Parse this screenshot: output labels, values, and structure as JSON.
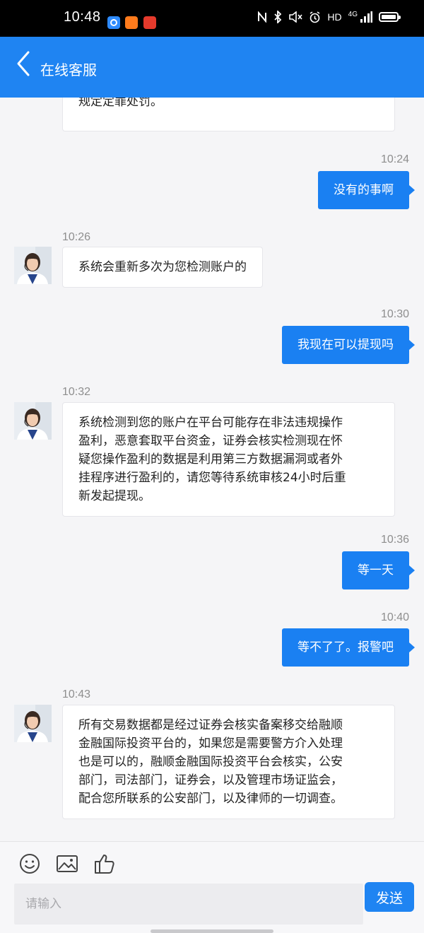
{
  "status_bar": {
    "time": "10:48",
    "network_label": "HD",
    "signal_label": "4G",
    "icons": [
      "app-browser-icon",
      "app-video-icon",
      "app-fast-icon",
      "nfc-icon",
      "bluetooth-icon",
      "mute-icon",
      "alarm-icon",
      "signal-icon",
      "battery-icon"
    ]
  },
  "header": {
    "title": "在线客服",
    "back_icon": "chevron-left-icon",
    "background": "#1f84f2"
  },
  "messages": [
    {
      "side": "left",
      "text": "规定定罪处罚。",
      "partial": true
    },
    {
      "side": "right",
      "time": "10:24",
      "text": "没有的事啊"
    },
    {
      "side": "left",
      "time": "10:26",
      "lines": [
        "系统会重新多次为您检测账户的"
      ]
    },
    {
      "side": "right",
      "time": "10:30",
      "text": "我现在可以提现吗"
    },
    {
      "side": "left",
      "time": "10:32",
      "lines": [
        "系统检测到您的账户在平台可能存在非法违规操作",
        "盈利，恶意套取平台资金，证券会核实检测现在怀",
        "疑您操作盈利的数据是利用第三方数据漏洞或者外",
        "挂程序进行盈利的，请您等待系统审核24小时后重",
        "新发起提现。"
      ]
    },
    {
      "side": "right",
      "time": "10:36",
      "text": "等一天"
    },
    {
      "side": "right",
      "time": "10:40",
      "text": "等不了了。报警吧"
    },
    {
      "side": "left",
      "time": "10:43",
      "lines": [
        "所有交易数据都是经过证券会核实备案移交给融顺",
        "金融国际投资平台的，如果您是需要警方介入处理",
        "也是可以的，融顺金融国际投资平台会核实，公安",
        "部门，司法部门，证券会，以及管理市场证监会，",
        "配合您所联系的公安部门，以及律师的一切调查。"
      ]
    }
  ],
  "composer": {
    "tool_icons": [
      "emoji-icon",
      "image-icon",
      "thumbs-up-icon"
    ],
    "input_placeholder": "请输入",
    "send_label": "发送"
  },
  "colors": {
    "accent": "#1f84f2",
    "outgoing_bubble": "#1a80f2",
    "incoming_bubble": "#ffffff",
    "background": "#f5f5f7",
    "timestamp": "#8e8e8e"
  }
}
